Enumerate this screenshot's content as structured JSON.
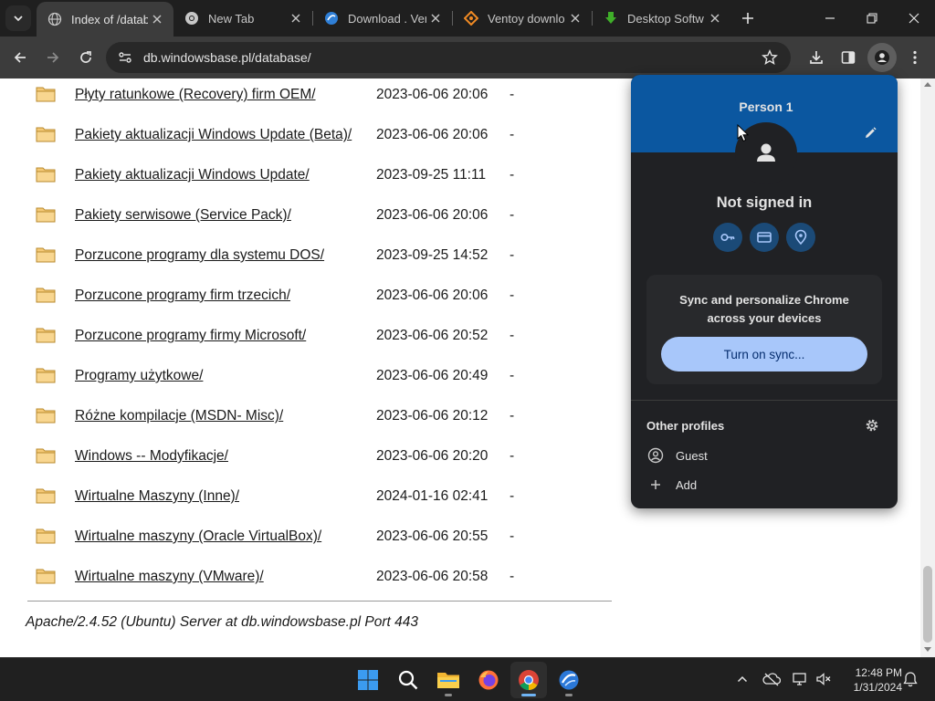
{
  "tabs": [
    {
      "title": "Index of /datab",
      "active": true,
      "favicon": "globe-icon"
    },
    {
      "title": "New Tab",
      "active": false,
      "favicon": "chrome-icon"
    },
    {
      "title": "Download . Ver",
      "active": false,
      "favicon": "site-blue-icon"
    },
    {
      "title": "Ventoy downlo",
      "active": false,
      "favicon": "ventoy-icon"
    },
    {
      "title": "Desktop Softw",
      "active": false,
      "favicon": "download-green-icon"
    }
  ],
  "toolbar": {
    "url": "db.windowsbase.pl/database/"
  },
  "listing": [
    {
      "name": "Płyty ratunkowe (Recovery) firm OEM/",
      "date": "2023-06-06 20:06",
      "size": "-"
    },
    {
      "name": "Pakiety aktualizacji Windows Update (Beta)/",
      "date": "2023-06-06 20:06",
      "size": "-"
    },
    {
      "name": "Pakiety aktualizacji Windows Update/",
      "date": "2023-09-25 11:11",
      "size": "-"
    },
    {
      "name": "Pakiety serwisowe (Service Pack)/",
      "date": "2023-06-06 20:06",
      "size": "-"
    },
    {
      "name": "Porzucone programy dla systemu DOS/",
      "date": "2023-09-25 14:52",
      "size": "-"
    },
    {
      "name": "Porzucone programy firm trzecich/",
      "date": "2023-06-06 20:06",
      "size": "-"
    },
    {
      "name": "Porzucone programy firmy Microsoft/",
      "date": "2023-06-06 20:52",
      "size": "-"
    },
    {
      "name": "Programy użytkowe/",
      "date": "2023-06-06 20:49",
      "size": "-"
    },
    {
      "name": "Różne kompilacje (MSDN- Misc)/",
      "date": "2023-06-06 20:12",
      "size": "-"
    },
    {
      "name": "Windows -- Modyfikacje/",
      "date": "2023-06-06 20:20",
      "size": "-"
    },
    {
      "name": "Wirtualne Maszyny (Inne)/",
      "date": "2024-01-16 02:41",
      "size": "-"
    },
    {
      "name": "Wirtualne maszyny (Oracle VirtualBox)/",
      "date": "2023-06-06 20:55",
      "size": "-"
    },
    {
      "name": "Wirtualne maszyny (VMware)/",
      "date": "2023-06-06 20:58",
      "size": "-"
    }
  ],
  "server_signature": "Apache/2.4.52 (Ubuntu) Server at db.windowsbase.pl Port 443",
  "profile_menu": {
    "name": "Person 1",
    "status": "Not signed in",
    "quick_icons": [
      "key-icon",
      "credit-card-icon",
      "location-pin-icon"
    ],
    "sync_text": "Sync and personalize Chrome across your devices",
    "sync_button": "Turn on sync...",
    "other_profiles_header": "Other profiles",
    "other_profiles": [
      {
        "label": "Guest",
        "icon": "guest-icon"
      },
      {
        "label": "Add",
        "icon": "plus-icon"
      }
    ],
    "colors": {
      "banner": "#0b57a0",
      "button": "#a8c7fa",
      "background": "#202124"
    }
  },
  "taskbar": {
    "apps": [
      "start-icon",
      "search-icon",
      "file-explorer-icon",
      "firefox-icon",
      "chrome-icon",
      "browser-icon"
    ],
    "time": "12:48 PM",
    "date": "1/31/2024"
  }
}
